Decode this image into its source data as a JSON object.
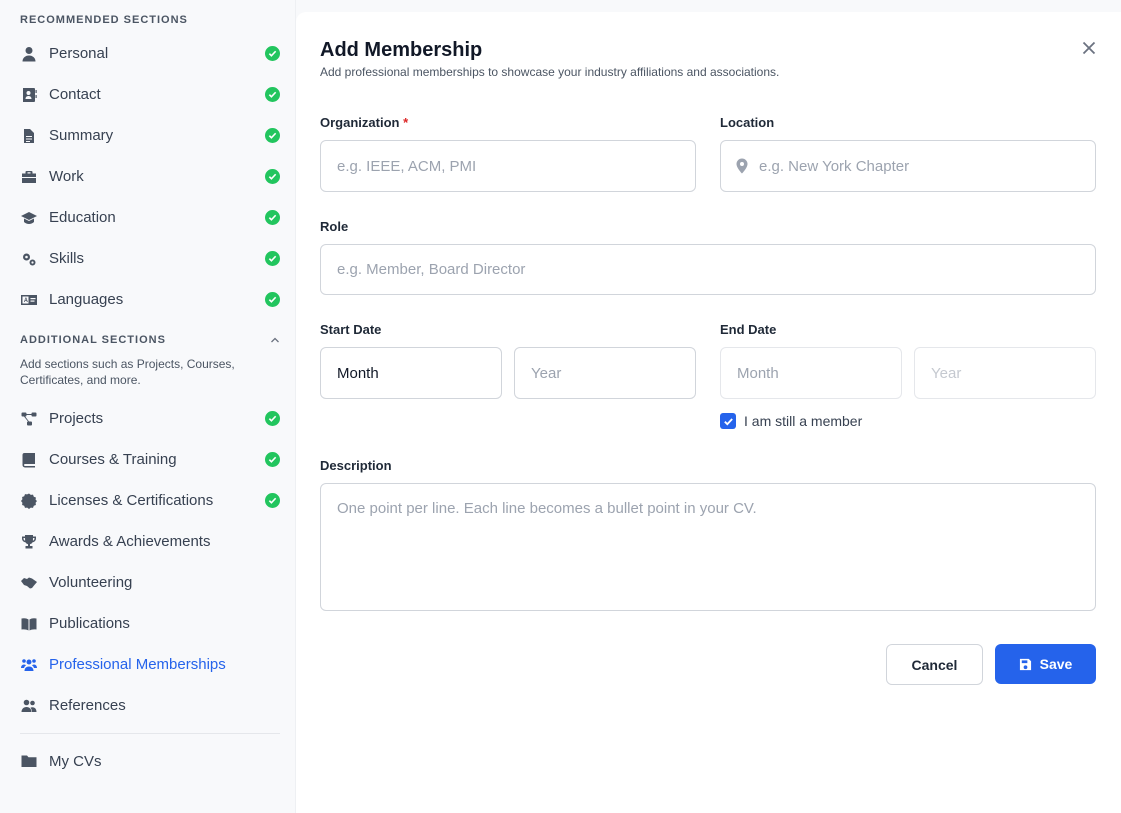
{
  "sidebar": {
    "recommended_heading": "RECOMMENDED SECTIONS",
    "recommended": [
      {
        "label": "Personal",
        "icon": "user-icon",
        "done": true
      },
      {
        "label": "Contact",
        "icon": "contact-card-icon",
        "done": true
      },
      {
        "label": "Summary",
        "icon": "document-icon",
        "done": true
      },
      {
        "label": "Work",
        "icon": "briefcase-icon",
        "done": true
      },
      {
        "label": "Education",
        "icon": "graduation-cap-icon",
        "done": true
      },
      {
        "label": "Skills",
        "icon": "gears-icon",
        "done": true
      },
      {
        "label": "Languages",
        "icon": "language-icon",
        "done": true
      }
    ],
    "additional_heading": "ADDITIONAL SECTIONS",
    "additional_desc": "Add sections such as Projects, Courses, Certificates, and more.",
    "additional": [
      {
        "label": "Projects",
        "icon": "diagram-icon",
        "done": true
      },
      {
        "label": "Courses & Training",
        "icon": "book-icon",
        "done": true
      },
      {
        "label": "Licenses & Certifications",
        "icon": "certificate-icon",
        "done": true
      },
      {
        "label": "Awards & Achievements",
        "icon": "trophy-icon",
        "done": false
      },
      {
        "label": "Volunteering",
        "icon": "handshake-icon",
        "done": false
      },
      {
        "label": "Publications",
        "icon": "open-book-icon",
        "done": false
      },
      {
        "label": "Professional Memberships",
        "icon": "users-icon",
        "done": false,
        "active": true
      },
      {
        "label": "References",
        "icon": "people-icon",
        "done": false
      }
    ],
    "my_cvs": "My CVs"
  },
  "modal": {
    "title": "Add Membership",
    "subtitle": "Add professional memberships to showcase your industry affiliations and associations.",
    "organization": {
      "label": "Organization",
      "required": "*",
      "placeholder": "e.g. IEEE, ACM, PMI"
    },
    "location": {
      "label": "Location",
      "placeholder": "e.g. New York Chapter"
    },
    "role": {
      "label": "Role",
      "placeholder": "e.g. Member, Board Director"
    },
    "start_date": {
      "label": "Start Date",
      "month": "Month",
      "year": "Year"
    },
    "end_date": {
      "label": "End Date",
      "month": "Month",
      "year": "Year"
    },
    "still_member": {
      "label": "I am still a member",
      "checked": true
    },
    "description": {
      "label": "Description",
      "placeholder": "One point per line. Each line becomes a bullet point in your CV."
    },
    "cancel": "Cancel",
    "save": "Save"
  },
  "colors": {
    "accent": "#2563eb",
    "success": "#22c55e",
    "required": "#dc2626"
  }
}
